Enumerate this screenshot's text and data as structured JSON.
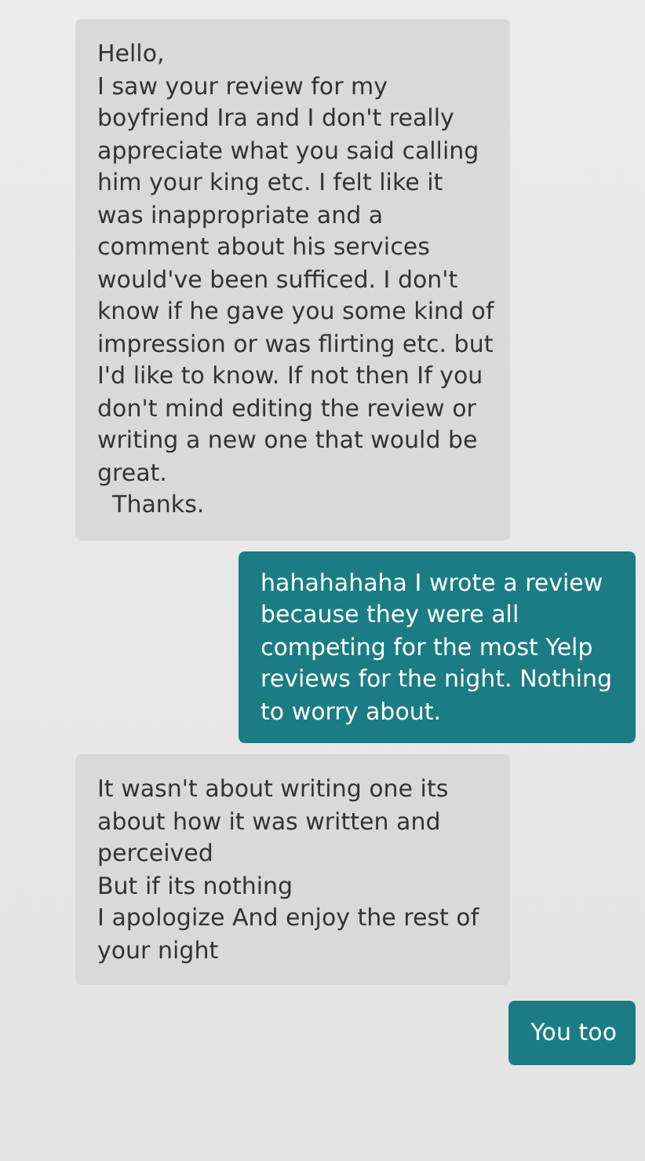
{
  "messages": [
    {
      "kind": "incoming",
      "text": "Hello,\nI saw your review for my boyfriend Ira and I don't really appreciate what you said calling him your king etc. I felt like it was inappropriate and a comment about his services would've been sufficed. I don't know if he gave you some kind of impression or was flirting etc. but I'd like to know. If not then If you don't mind editing the review or writing a new one that would be great.\n  Thanks."
    },
    {
      "kind": "outgoing",
      "text": "hahahahaha I wrote a review because they were all competing for the most Yelp reviews for the night. Nothing to worry about."
    },
    {
      "kind": "incoming",
      "text": "It wasn't about writing one its about how it was written and perceived\nBut if its nothing\nI apologize And enjoy the rest of your night"
    },
    {
      "kind": "outgoing",
      "text": "You too"
    }
  ]
}
